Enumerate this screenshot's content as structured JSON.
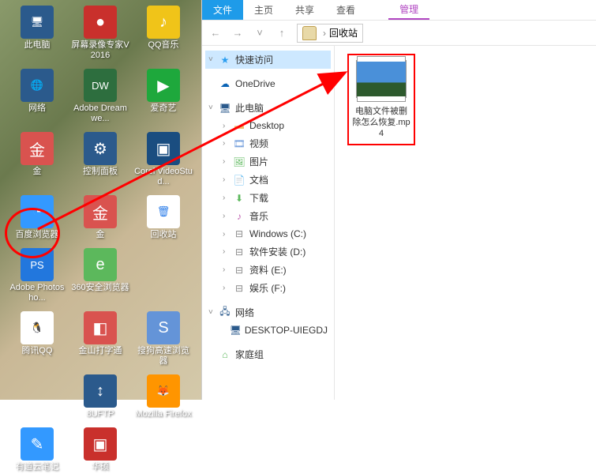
{
  "desktop": {
    "icons": [
      {
        "label": "此电脑",
        "cls": "ic-pc",
        "glyph": "🖥"
      },
      {
        "label": "屏幕录像专家V2016",
        "cls": "ic-rec",
        "glyph": "●"
      },
      {
        "label": "QQ音乐",
        "cls": "ic-qqm",
        "glyph": "♪"
      },
      {
        "label": "网络",
        "cls": "ic-net",
        "glyph": "🌐"
      },
      {
        "label": "Adobe Dreamwe...",
        "cls": "ic-dw",
        "glyph": "DW"
      },
      {
        "label": "爱奇艺",
        "cls": "ic-iqy",
        "glyph": "▶"
      },
      {
        "label": "金",
        "cls": "ic-jin",
        "glyph": "金"
      },
      {
        "label": "控制面板",
        "cls": "ic-ctrl",
        "glyph": "⚙"
      },
      {
        "label": "Corel VideoStud...",
        "cls": "ic-cvs",
        "glyph": "▣"
      },
      {
        "label": "百度浏览器",
        "cls": "ic-baidu",
        "glyph": "◔"
      },
      {
        "label": "金",
        "cls": "ic-jin",
        "glyph": "金"
      },
      {
        "label": "回收站",
        "cls": "ic-bin",
        "glyph": "🗑"
      },
      {
        "label": "Adobe Photosho...",
        "cls": "ic-ps",
        "glyph": "PS"
      },
      {
        "label": "360安全浏览器",
        "cls": "ic-360",
        "glyph": "e"
      },
      {
        "label": "",
        "cls": "",
        "glyph": ""
      },
      {
        "label": "腾讯QQ",
        "cls": "ic-qq",
        "glyph": "🐧"
      },
      {
        "label": "金山打字通",
        "cls": "ic-jsd",
        "glyph": "◧"
      },
      {
        "label": "搜狗高速浏览器",
        "cls": "ic-sogou",
        "glyph": "S"
      },
      {
        "label": "",
        "cls": "",
        "glyph": ""
      },
      {
        "label": "8UFTP",
        "cls": "ic-8uftp",
        "glyph": "↕"
      },
      {
        "label": "Mozilla Firefox",
        "cls": "ic-fx",
        "glyph": "🦊"
      },
      {
        "label": "有道云笔记",
        "cls": "ic-ydy",
        "glyph": "✎"
      },
      {
        "label": "华硕",
        "cls": "ic-hs",
        "glyph": "▣"
      }
    ]
  },
  "explorer": {
    "tabs": {
      "file": "文件",
      "home": "主页",
      "share": "共享",
      "view": "查看",
      "manage": "管理"
    },
    "breadcrumb": {
      "location": "回收站"
    },
    "tree": {
      "quick_access": "快速访问",
      "onedrive": "OneDrive",
      "this_pc": "此电脑",
      "desktop": "Desktop",
      "videos": "视频",
      "pictures": "图片",
      "documents": "文档",
      "downloads": "下载",
      "music": "音乐",
      "drive_c": "Windows (C:)",
      "drive_d": "软件安装 (D:)",
      "drive_e": "资料 (E:)",
      "drive_f": "娱乐 (F:)",
      "network": "网络",
      "computer_name": "DESKTOP-UIEGDJ",
      "homegroup": "家庭组"
    },
    "file": {
      "name": "电脑文件被删除怎么恢复.mp4"
    }
  }
}
